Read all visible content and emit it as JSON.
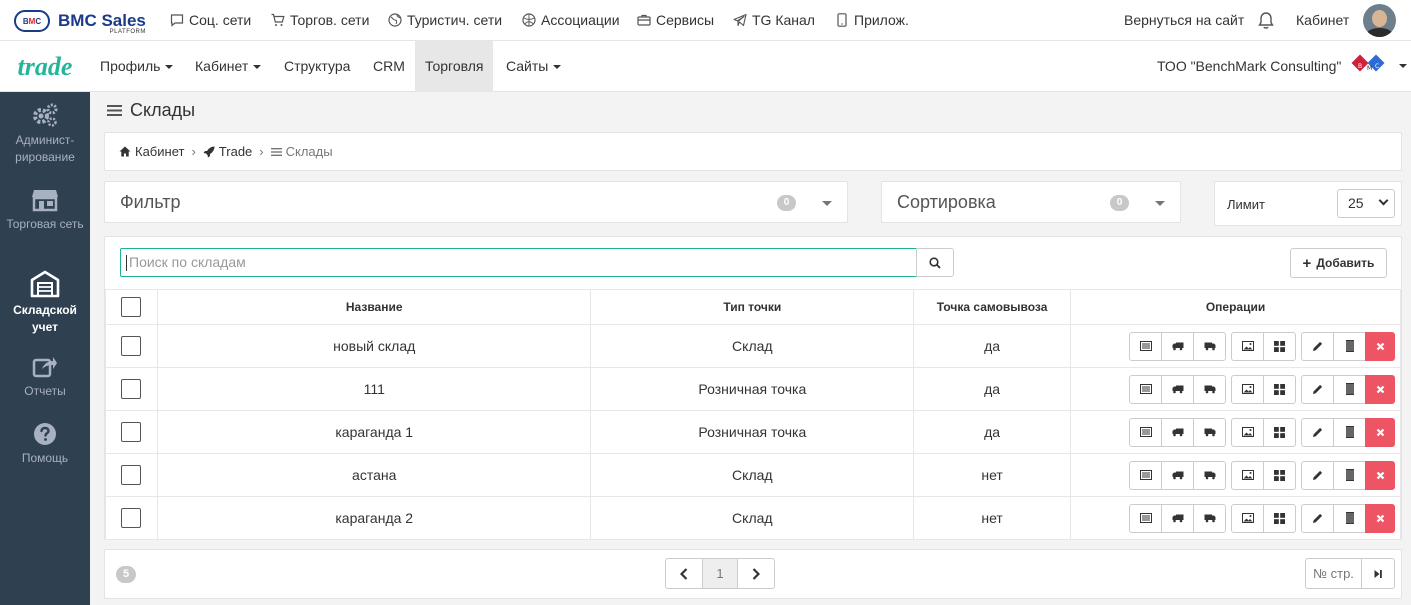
{
  "topbar": {
    "logo_badge": [
      "B",
      "M",
      "C"
    ],
    "logo_text": "BMC Sales",
    "logo_sub": "PLATFORM",
    "links": [
      {
        "label": "Соц. сети",
        "icon": "chat-icon"
      },
      {
        "label": "Торгов. сети",
        "icon": "cart-icon"
      },
      {
        "label": "Туристич. сети",
        "icon": "globe-icon"
      },
      {
        "label": "Ассоциации",
        "icon": "ball-icon"
      },
      {
        "label": "Сервисы",
        "icon": "briefcase-icon"
      },
      {
        "label": "TG Канал",
        "icon": "telegram-icon"
      },
      {
        "label": "Прилож.",
        "icon": "mobile-icon"
      }
    ],
    "back_to_site": "Вернуться на сайт",
    "cabinet": "Кабинет"
  },
  "navbar": {
    "brand": "trade",
    "items": [
      {
        "label": "Профиль",
        "dropdown": true
      },
      {
        "label": "Кабинет",
        "dropdown": true
      },
      {
        "label": "Структура",
        "dropdown": false
      },
      {
        "label": "CRM",
        "dropdown": false
      },
      {
        "label": "Торговля",
        "dropdown": false,
        "active": true
      },
      {
        "label": "Сайты",
        "dropdown": true
      }
    ],
    "company": "ТОО \"BenchMark Consulting\""
  },
  "sidebar": {
    "items": [
      {
        "label": "Админист-рирование",
        "icon": "gears-icon"
      },
      {
        "label": "Торговая сеть",
        "icon": "store-icon"
      },
      {
        "label": "Складской учет",
        "icon": "warehouse-icon",
        "active": true
      },
      {
        "label": "Отчеты",
        "icon": "share-icon"
      },
      {
        "label": "Помощь",
        "icon": "question-icon"
      }
    ]
  },
  "page": {
    "title": "Склады",
    "breadcrumb": [
      "Кабинет",
      "Trade",
      "Склады"
    ]
  },
  "filter": {
    "label": "Фильтр",
    "count": "0"
  },
  "sort": {
    "label": "Сортировка",
    "count": "0"
  },
  "limit": {
    "label": "Лимит",
    "value": "25"
  },
  "search": {
    "placeholder": "Поиск по складам"
  },
  "add_button": "Добавить",
  "table": {
    "columns": [
      "Название",
      "Тип точки",
      "Точка самовывоза",
      "Операции"
    ],
    "rows": [
      {
        "name": "новый склад",
        "type": "Склад",
        "pickup": "да"
      },
      {
        "name": "111",
        "type": "Розничная точка",
        "pickup": "да"
      },
      {
        "name": "караганда 1",
        "type": "Розничная точка",
        "pickup": "да"
      },
      {
        "name": "астана",
        "type": "Склад",
        "pickup": "нет"
      },
      {
        "name": "караганда 2",
        "type": "Склад",
        "pickup": "нет"
      }
    ]
  },
  "footer": {
    "total": "5",
    "current_page": "1",
    "goto_placeholder": "№ стр."
  },
  "colors": {
    "accent": "#1ab394",
    "sidebar": "#2f4050",
    "danger": "#ed5565",
    "brand": "#26b59b"
  }
}
